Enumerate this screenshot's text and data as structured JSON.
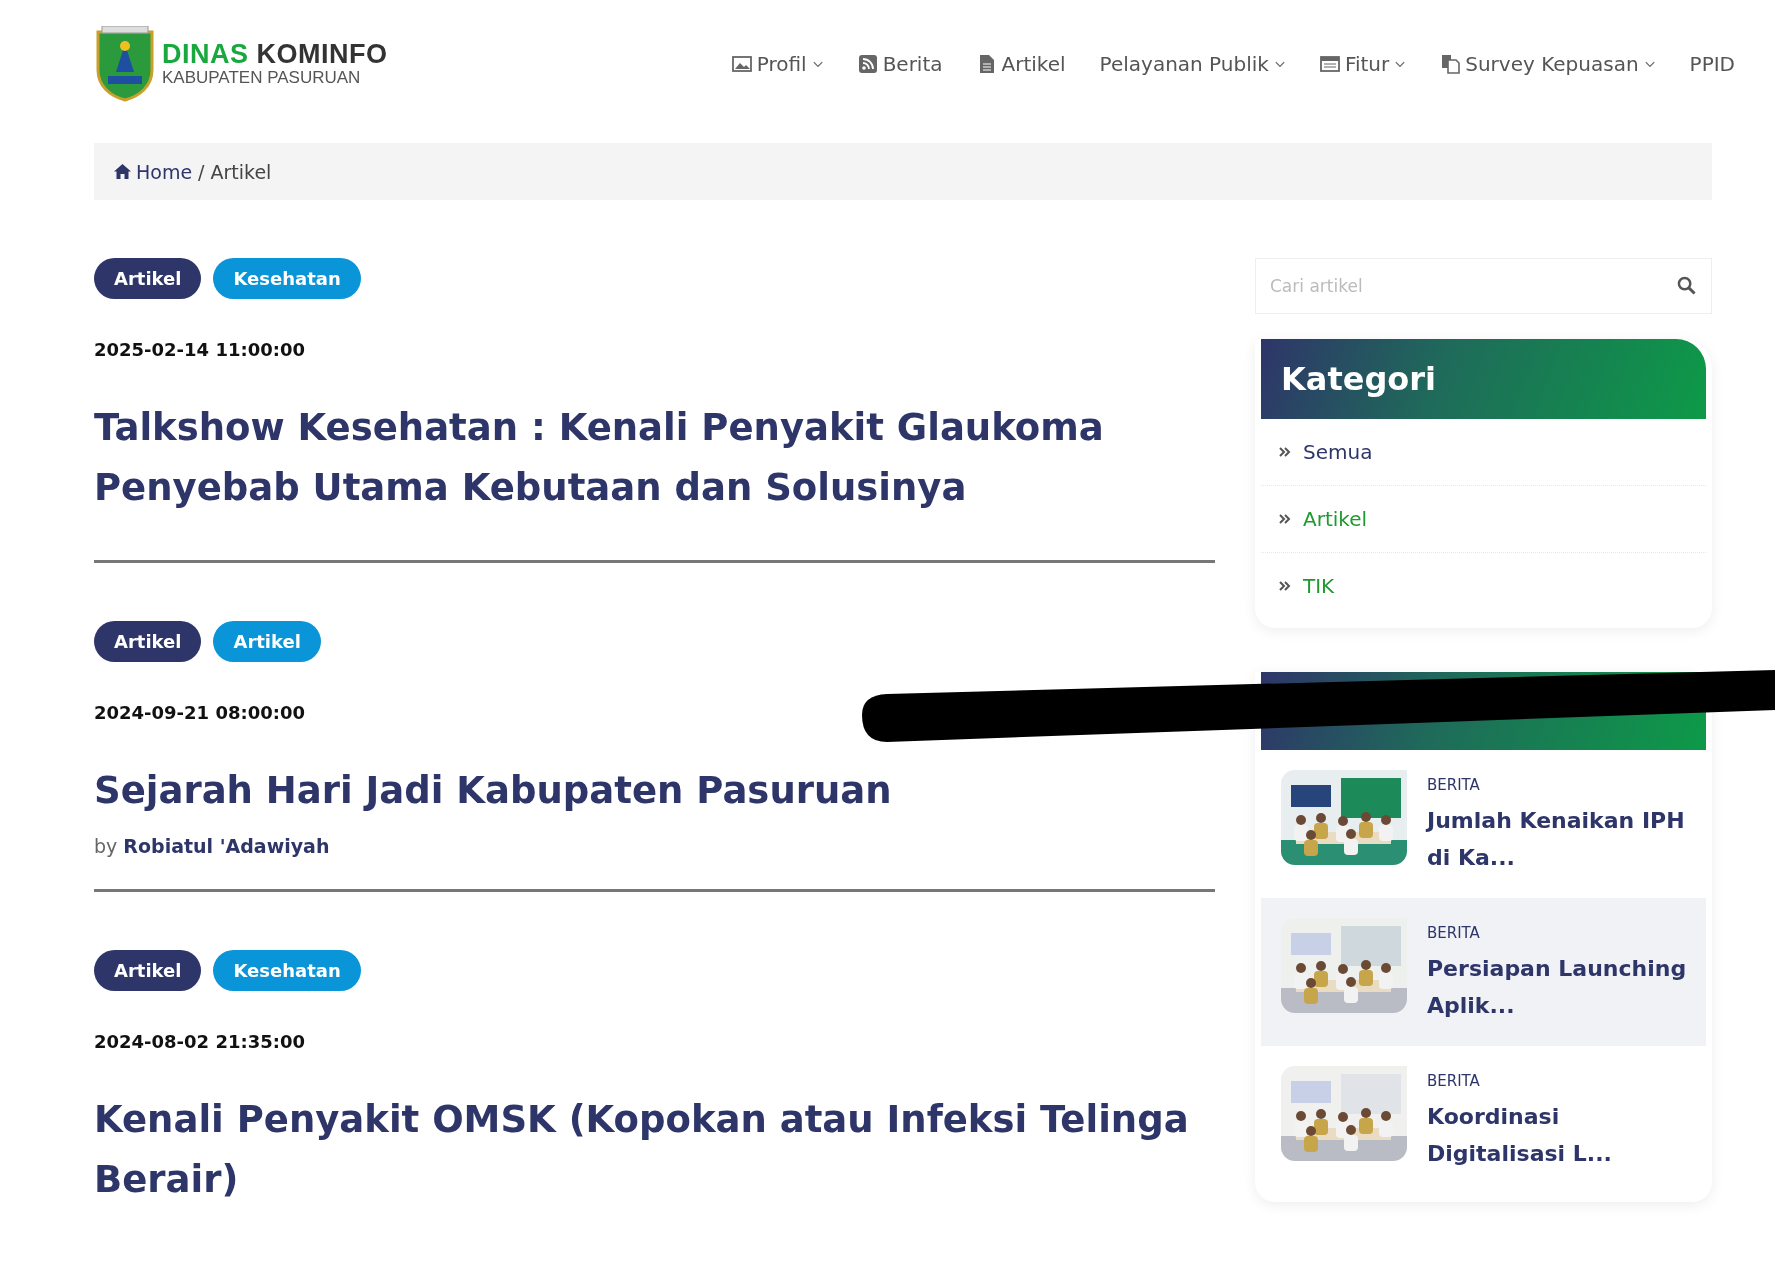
{
  "header": {
    "logo": {
      "line1_green": "DINAS",
      "line1_dark": "KOMINFO",
      "line2": "KABUPATEN PASURUAN"
    },
    "nav": [
      {
        "label": "Profil",
        "dropdown": true
      },
      {
        "label": "Berita",
        "dropdown": false
      },
      {
        "label": "Artikel",
        "dropdown": false
      },
      {
        "label": "Pelayanan Publik",
        "dropdown": true
      },
      {
        "label": "Fitur",
        "dropdown": true
      },
      {
        "label": "Survey Kepuasan",
        "dropdown": true
      },
      {
        "label": "PPID",
        "dropdown": false
      }
    ]
  },
  "breadcrumb": {
    "separator": "/",
    "items": [
      {
        "label": "Home",
        "link": true
      },
      {
        "label": "Artikel",
        "link": false
      }
    ]
  },
  "articles": [
    {
      "tags": [
        {
          "label": "Artikel",
          "kind": "type"
        },
        {
          "label": "Kesehatan",
          "kind": "category"
        }
      ],
      "date": "2025-02-14 11:00:00",
      "title": "Talkshow Kesehatan : Kenali Penyakit Glaukoma Penyebab Utama Kebutaan dan Solusinya"
    },
    {
      "tags": [
        {
          "label": "Artikel",
          "kind": "type"
        },
        {
          "label": "Artikel",
          "kind": "category"
        }
      ],
      "date": "2024-09-21 08:00:00",
      "title": "Sejarah Hari Jadi Kabupaten Pasuruan",
      "by": "by",
      "author": "Robiatul 'Adawiyah"
    },
    {
      "tags": [
        {
          "label": "Artikel",
          "kind": "type"
        },
        {
          "label": "Kesehatan",
          "kind": "category"
        }
      ],
      "date": "2024-08-02 21:35:00",
      "title": "Kenali Penyakit OMSK (Kopokan atau Infeksi Telinga Berair)"
    }
  ],
  "sidebar": {
    "search": {
      "placeholder": "Cari artikel"
    },
    "categories": {
      "title": "Kategori",
      "items": [
        {
          "label": "Semua",
          "color": "#2e3569"
        },
        {
          "label": "Artikel",
          "color": "#1f9a2e"
        },
        {
          "label": "TIK",
          "color": "#1f9a2e"
        }
      ]
    },
    "news": {
      "title_redacted": true,
      "items": [
        {
          "category": "BERITA",
          "title": "Jumlah Kenaikan IPH di Ka...",
          "highlighted": false
        },
        {
          "category": "BERITA",
          "title": "Persiapan Launching Aplik...",
          "highlighted": true
        },
        {
          "category": "BERITA",
          "title": "Koordinasi Digitalisasi L...",
          "highlighted": false
        }
      ]
    }
  }
}
